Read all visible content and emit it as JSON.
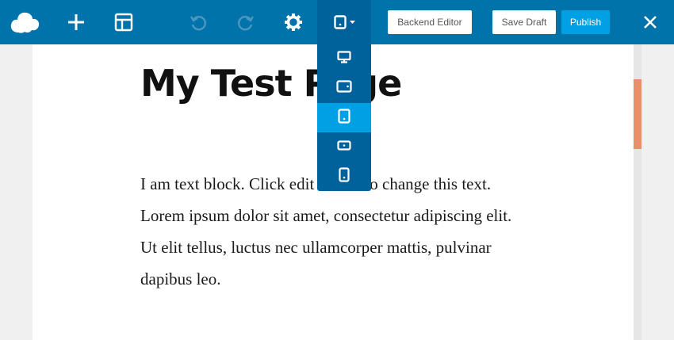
{
  "toolbar": {
    "backend_editor_label": "Backend Editor",
    "save_draft_label": "Save Draft",
    "publish_label": "Publish"
  },
  "device_menu": {
    "items": [
      {
        "icon": "desktop-icon",
        "active": false
      },
      {
        "icon": "tablet-landscape-icon",
        "active": false
      },
      {
        "icon": "tablet-portrait-icon",
        "active": true
      },
      {
        "icon": "mobile-landscape-icon",
        "active": false
      },
      {
        "icon": "mobile-portrait-icon",
        "active": false
      }
    ]
  },
  "page": {
    "title": "My Test Page",
    "text": "I am text block. Click edit button to change this text. Lorem ipsum dolor sit amet, consectetur adipiscing elit. Ut elit tellus, luctus nec ullamcorper mattis, pulvinar dapibus leo."
  },
  "colors": {
    "toolbar_bg": "#0073aa",
    "dropdown_bg": "#00629a",
    "accent": "#00a0e4",
    "scroll_thumb": "#e9906b"
  }
}
